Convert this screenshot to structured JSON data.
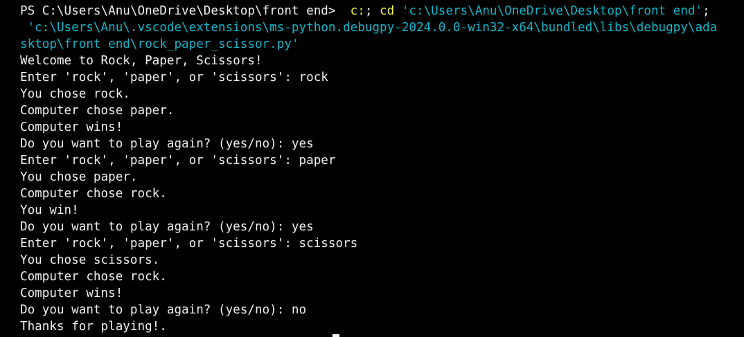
{
  "colors": {
    "background": "#000000",
    "text": "#f0f0f0",
    "command": "#f5f543",
    "string": "#11b5c9"
  },
  "prompt": {
    "ps_prefix": "PS C:\\Users\\Anu\\OneDrive\\Desktop\\front end>  ",
    "cmd1": "c:",
    "sep1": "; ",
    "cmd2": "cd",
    "sep2": " ",
    "arg1": "'c:\\Users\\Anu\\OneDrive\\Desktop\\front end'",
    "sep3": ";",
    "line2": " 'c:\\Users\\Anu\\.vscode\\extensions\\ms-python.debugpy-2024.0.0-win32-x64\\bundled\\libs\\debugpy\\ada",
    "line3": "sktop\\front end\\rock_paper_scissor.py'"
  },
  "output": [
    "Welcome to Rock, Paper, Scissors!",
    "Enter 'rock', 'paper', or 'scissors': rock",
    "You chose rock.",
    "Computer chose paper.",
    "Computer wins!",
    "Do you want to play again? (yes/no): yes",
    "Enter 'rock', 'paper', or 'scissors': paper",
    "You chose paper.",
    "Computer chose rock.",
    "You win!",
    "Do you want to play again? (yes/no): yes",
    "Enter 'rock', 'paper', or 'scissors': scissors",
    "You chose scissors.",
    "Computer chose rock.",
    "Computer wins!",
    "Do you want to play again? (yes/no): no",
    "Thanks for playing!."
  ]
}
